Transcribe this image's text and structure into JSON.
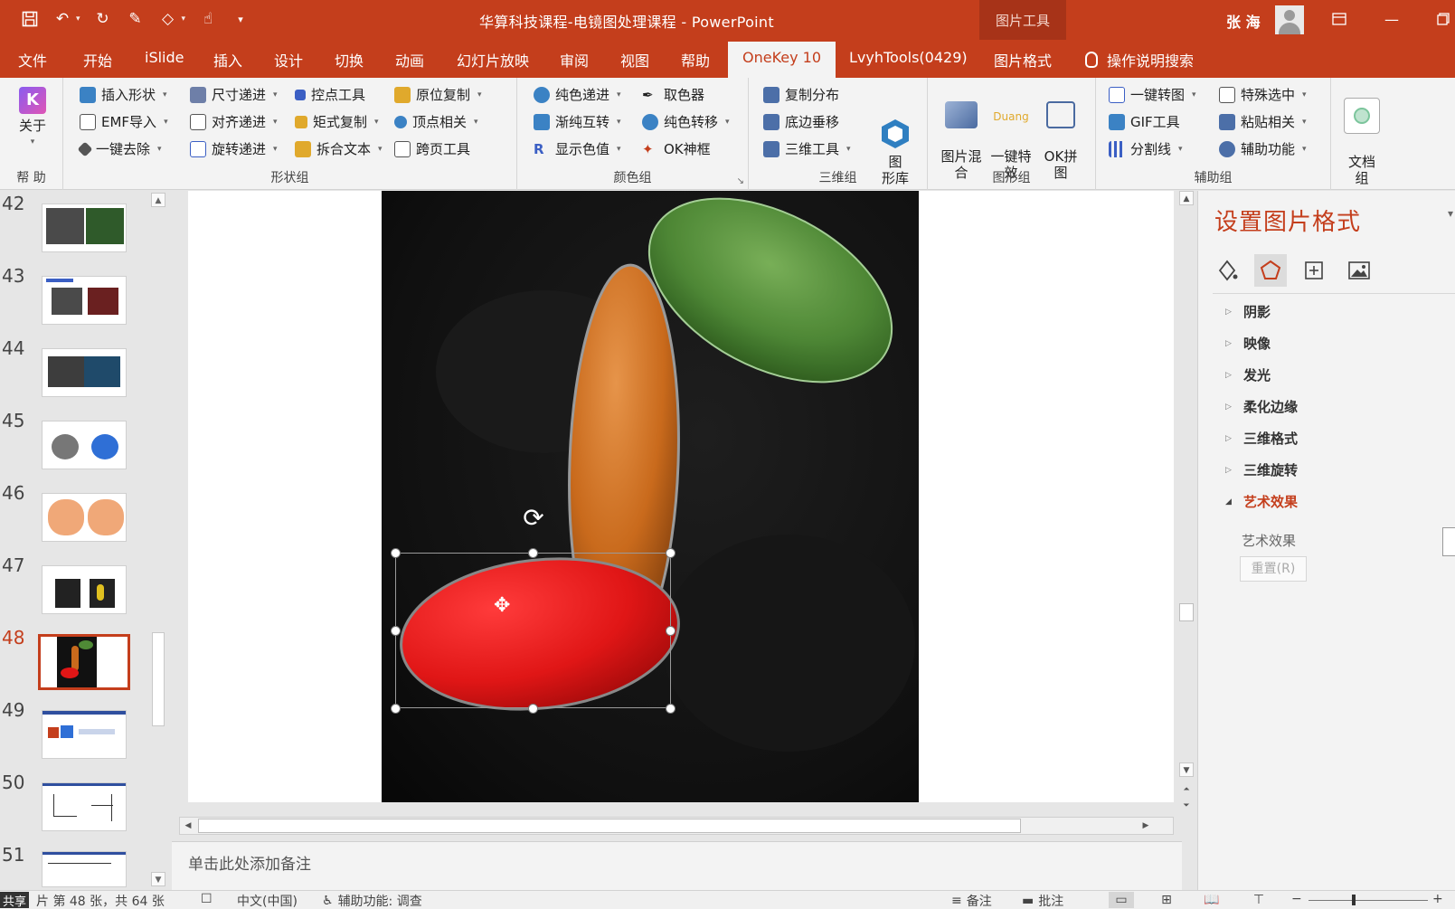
{
  "titlebar": {
    "document_title": "华算科技课程-电镜图处理课程  -  PowerPoint",
    "context_tab_label": "图片工具",
    "user_name": "张 海"
  },
  "tabs": [
    "文件",
    "开始",
    "iSlide",
    "插入",
    "设计",
    "切换",
    "动画",
    "幻灯片放映",
    "审阅",
    "视图",
    "帮助",
    "OneKey 10",
    "LvyhTools(0429)",
    "图片格式"
  ],
  "active_tab": "OneKey 10",
  "tell_me": "操作说明搜索",
  "ribbon": {
    "help_group": {
      "about": "关于",
      "label": "帮 助"
    },
    "shape_group": {
      "label": "形状组",
      "items": [
        "插入形状",
        "尺寸递进",
        "控点工具",
        "原位复制",
        "EMF导入",
        "对齐递进",
        "矩式复制",
        "顶点相关",
        "一键去除",
        "旋转递进",
        "拆合文本",
        "跨页工具"
      ]
    },
    "color_group": {
      "label": "颜色组",
      "items": [
        "纯色递进",
        "取色器",
        "渐纯互转",
        "纯色转移",
        "显示色值",
        "OK神框"
      ]
    },
    "three_d_group": {
      "label": "三维组",
      "items": [
        "复制分布",
        "底边垂移",
        "三维工具"
      ],
      "big_button": "图\n形库"
    },
    "graphic_group": {
      "label": "图形组",
      "buttons": [
        "图片混\n合",
        "一键特\n效",
        "OK拼\n图"
      ],
      "duang": "Duang"
    },
    "aux_group": {
      "label": "辅助组",
      "items": [
        "一键转图",
        "特殊选中",
        "GIF工具",
        "粘贴相关",
        "分割线",
        "辅助功能"
      ],
      "big_button": "文档\n组"
    }
  },
  "thumbnails": [
    "42",
    "43",
    "44",
    "45",
    "46",
    "47",
    "48",
    "49",
    "50",
    "51"
  ],
  "selected_slide": "48",
  "notes_placeholder": "单击此处添加备注",
  "format_pane": {
    "title": "设置图片格式",
    "sections": [
      "阴影",
      "映像",
      "发光",
      "柔化边缘",
      "三维格式",
      "三维旋转",
      "艺术效果"
    ],
    "open_section": "艺术效果",
    "sub_label": "艺术效果",
    "reset_button": "重置(R)"
  },
  "statusbar": {
    "share": "共享",
    "slide_info": "片 第 48 张，共 64 张",
    "language": "中文(中国)",
    "accessibility": "辅助功能: 调查",
    "notes": "备注",
    "comments": "批注"
  },
  "colors": {
    "accent": "#c43e1c",
    "green_cell": "#4f8a36",
    "orange_cell": "#c96a1c",
    "red_cell": "#e01616"
  }
}
